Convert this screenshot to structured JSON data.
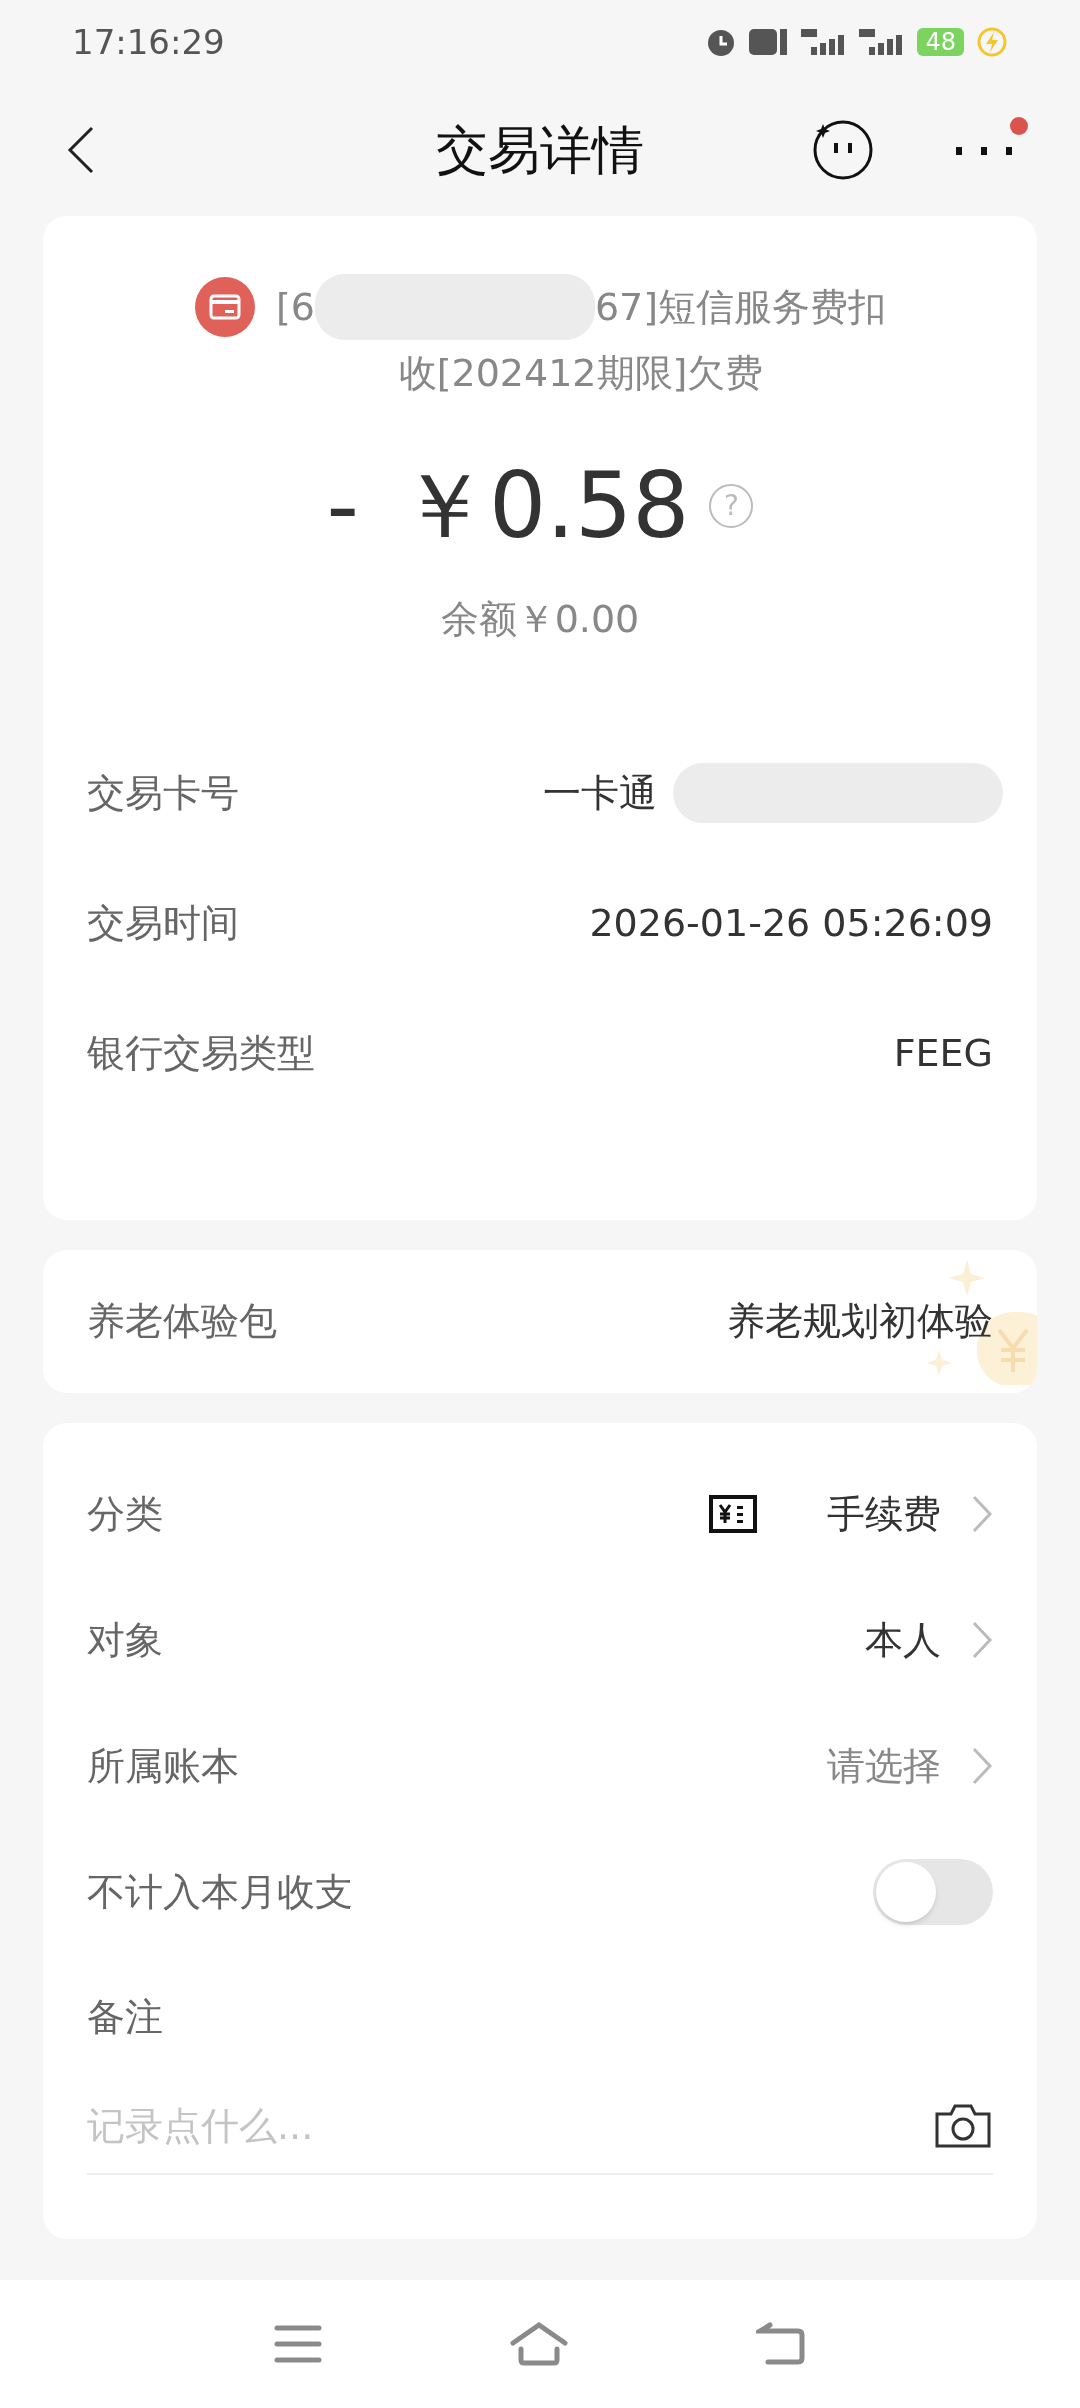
{
  "status_bar": {
    "time": "17:16:29",
    "battery": "48"
  },
  "header": {
    "title": "交易详情",
    "has_notification": true
  },
  "summary": {
    "description_start": "[6",
    "description_end": "67]短信服务费扣",
    "description_line2": "收[202412期限]欠费",
    "sign": "-",
    "amount": "￥0.58",
    "help": "?",
    "balance": "余额￥0.00"
  },
  "details": [
    {
      "label": "交易卡号",
      "value": "一卡通",
      "redacted": true
    },
    {
      "label": "交易时间",
      "value": "2026-01-26 05:26:09",
      "redacted": false
    },
    {
      "label": "银行交易类型",
      "value": "FEEG",
      "redacted": false
    }
  ],
  "promo": {
    "label": "养老体验包",
    "value": "养老规划初体验"
  },
  "settings": [
    {
      "kind": "link",
      "label": "分类",
      "value": "手续费",
      "has_icon": true,
      "muted": false
    },
    {
      "kind": "link",
      "label": "对象",
      "value": "本人",
      "has_icon": false,
      "muted": false
    },
    {
      "kind": "link",
      "label": "所属账本",
      "value": "请选择",
      "has_icon": false,
      "muted": true
    },
    {
      "kind": "toggle",
      "label": "不计入本月收支",
      "checked": false
    }
  ],
  "note": {
    "label": "备注",
    "placeholder": "记录点什么..."
  }
}
